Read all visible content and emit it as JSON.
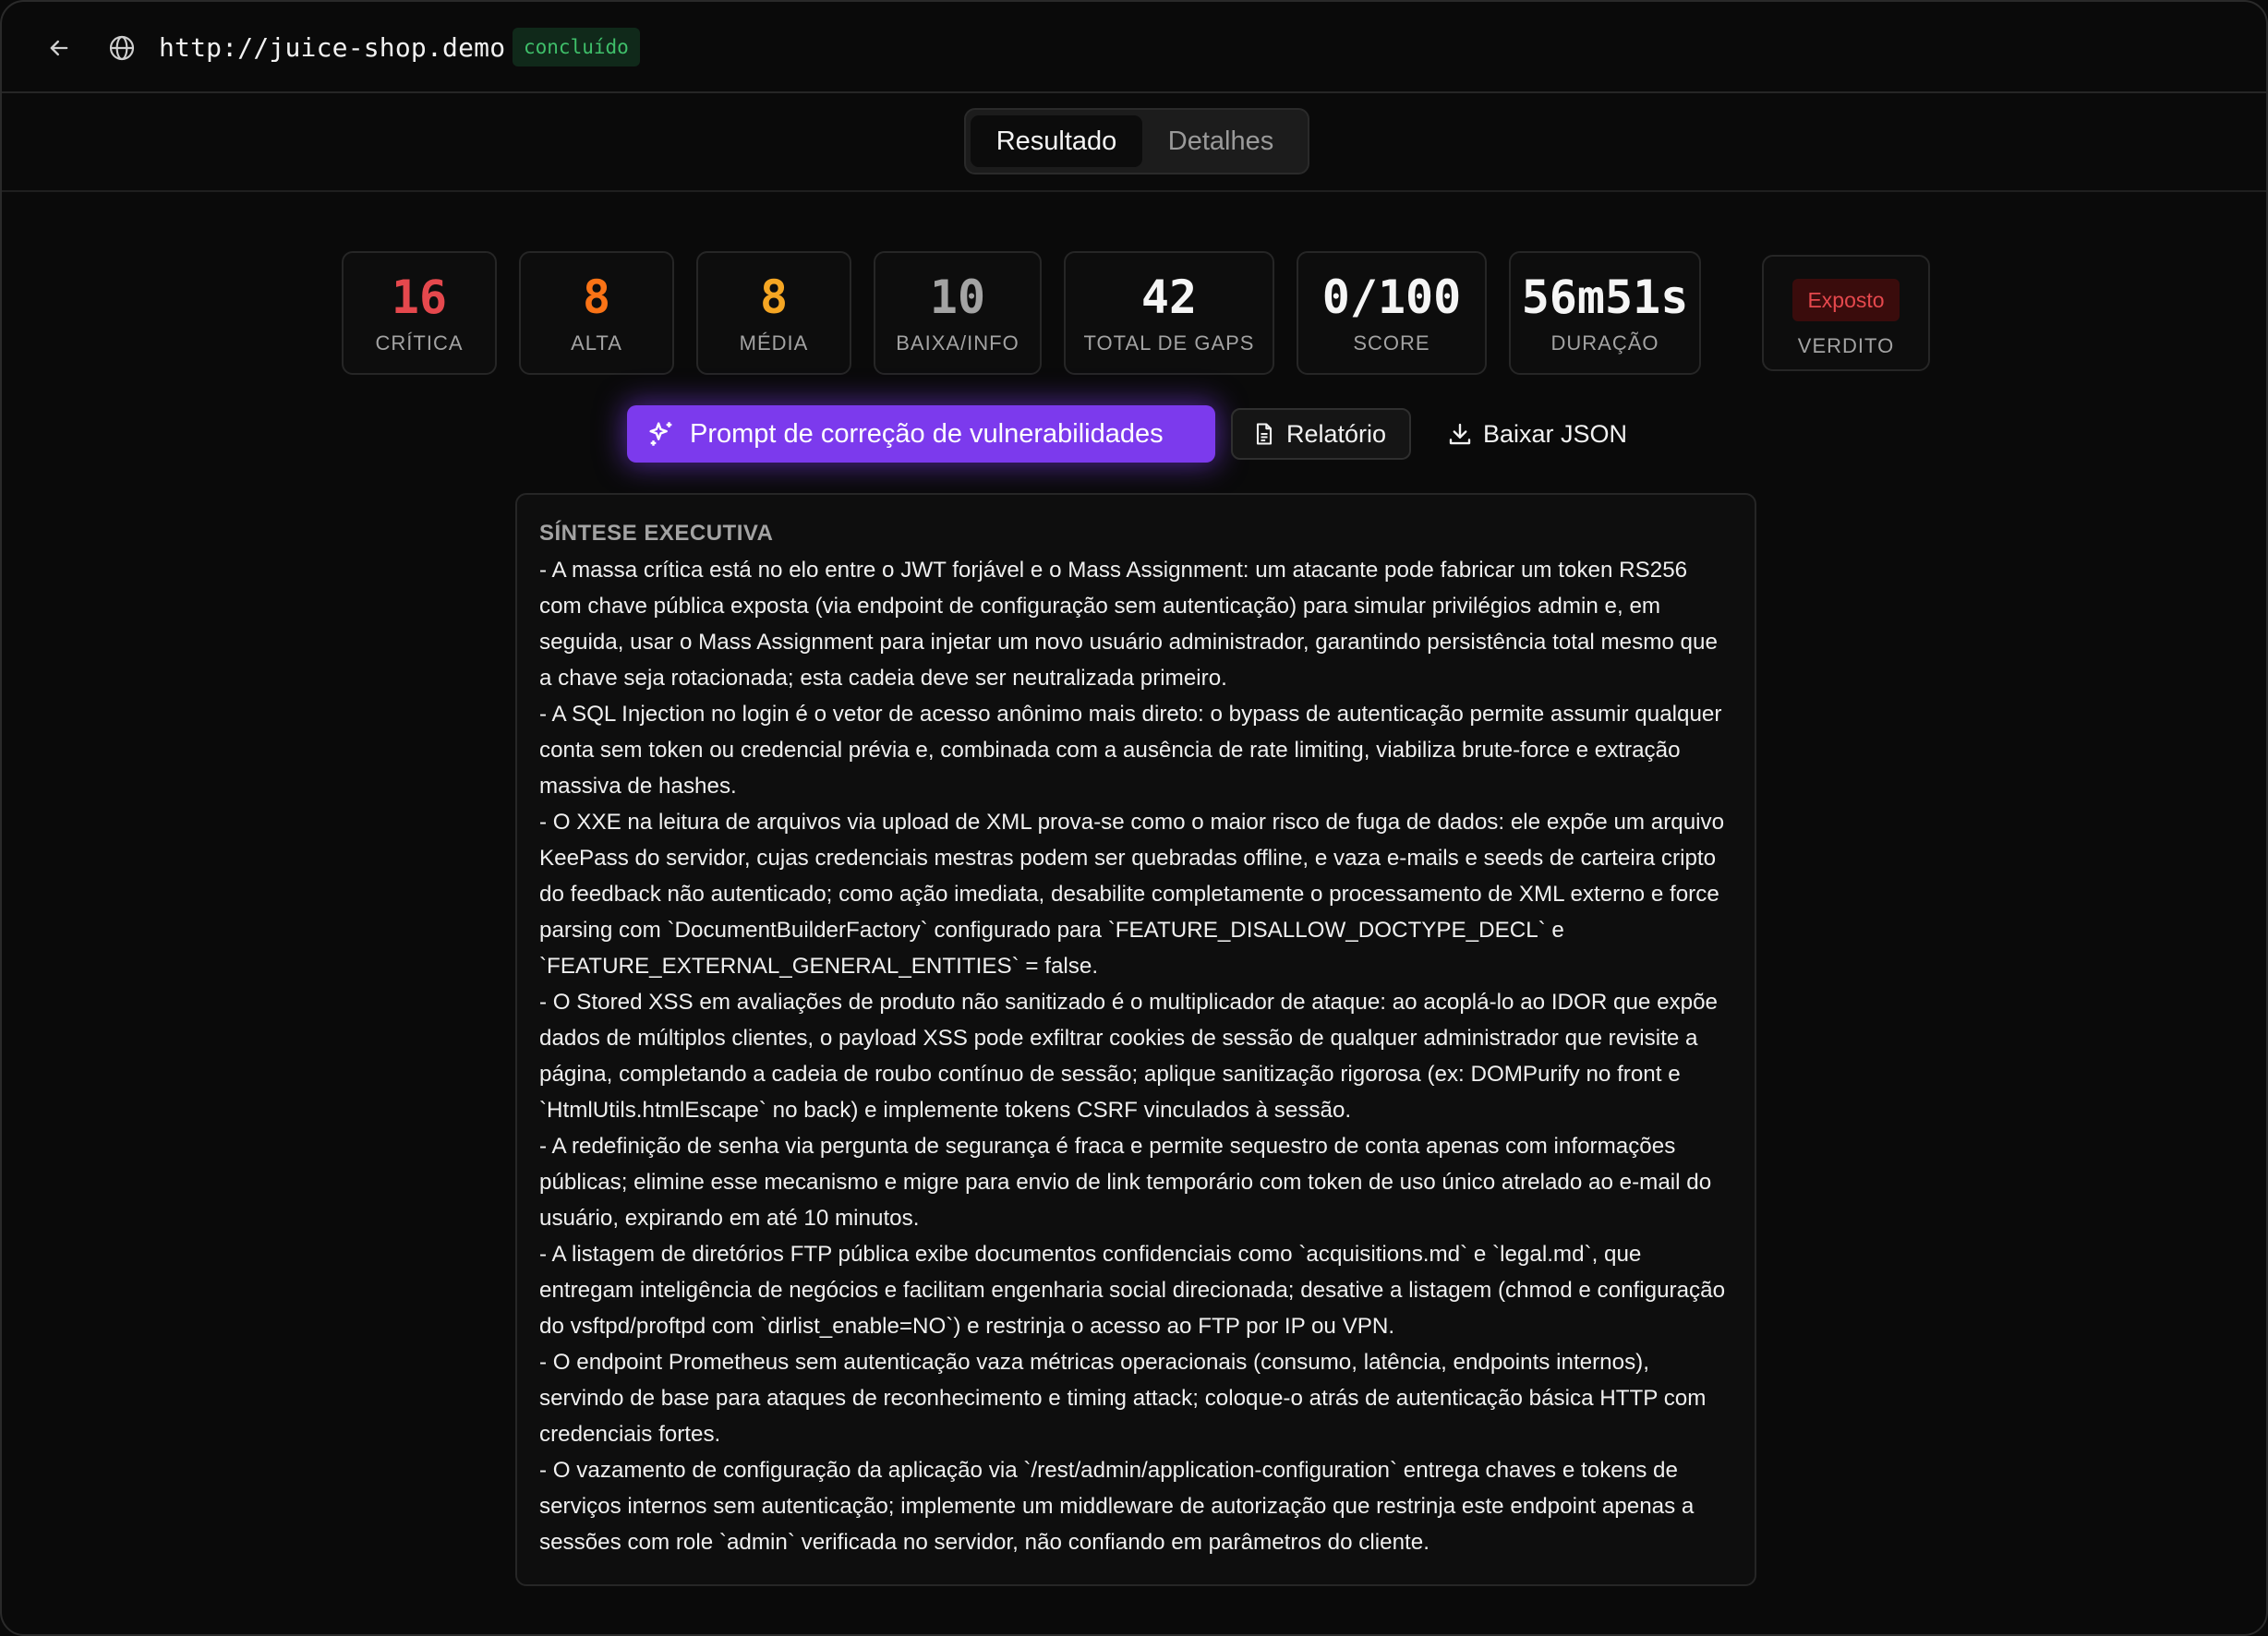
{
  "header": {
    "url": "http://juice-shop.demo",
    "status": "concluído"
  },
  "tabs": [
    {
      "label": "Resultado",
      "active": true
    },
    {
      "label": "Detalhes",
      "active": false
    }
  ],
  "stats": [
    {
      "value": "16",
      "label": "CRÍTICA",
      "color": "#e5484d"
    },
    {
      "value": "8",
      "label": "ALTA",
      "color": "#f97316"
    },
    {
      "value": "8",
      "label": "MÉDIA",
      "color": "#f5a623"
    },
    {
      "value": "10",
      "label": "BAIXA/INFO",
      "color": "#a3a3a3"
    },
    {
      "value": "42",
      "label": "TOTAL DE GAPS",
      "color": "#f5f5f5"
    },
    {
      "value": "0/100",
      "label": "SCORE",
      "color": "#f5f5f5"
    },
    {
      "value": "56m51s",
      "label": "DURAÇÃO",
      "color": "#f5f5f5"
    }
  ],
  "verdict": {
    "value": "Exposto",
    "label": "VERDITO"
  },
  "actions": {
    "prompt_label": "Prompt de correção de vulnerabilidades",
    "report_label": "Relatório",
    "json_label": "Baixar JSON"
  },
  "summary": {
    "title": "SÍNTESE EXECUTIVA",
    "paragraphs": [
      "- A massa crítica está no elo entre o JWT forjável e o Mass Assignment: um atacante pode fabricar um token RS256 com chave pública exposta (via endpoint de configuração sem autenticação) para simular privilégios admin e, em seguida, usar o Mass Assignment para injetar um novo usuário administrador, garantindo persistência total mesmo que a chave seja rotacionada; esta cadeia deve ser neutralizada primeiro.",
      "- A SQL Injection no login é o vetor de acesso anônimo mais direto: o bypass de autenticação permite assumir qualquer conta sem token ou credencial prévia e, combinada com a ausência de rate limiting, viabiliza brute-force e extração massiva de hashes.",
      "- O XXE na leitura de arquivos via upload de XML prova-se como o maior risco de fuga de dados: ele expõe um arquivo KeePass do servidor, cujas credenciais mestras podem ser quebradas offline, e vaza e-mails e seeds de carteira cripto do feedback não autenticado; como ação imediata, desabilite completamente o processamento de XML externo e force parsing com `DocumentBuilderFactory` configurado para `FEATURE_DISALLOW_DOCTYPE_DECL` e `FEATURE_EXTERNAL_GENERAL_ENTITIES` = false.",
      "- O Stored XSS em avaliações de produto não sanitizado é o multiplicador de ataque: ao acoplá-lo ao IDOR que expõe dados de múltiplos clientes, o payload XSS pode exfiltrar cookies de sessão de qualquer administrador que revisite a página, completando a cadeia de roubo contínuo de sessão; aplique sanitização rigorosa (ex: DOMPurify no front e `HtmlUtils.htmlEscape` no back) e implemente tokens CSRF vinculados à sessão.",
      "- A redefinição de senha via pergunta de segurança é fraca e permite sequestro de conta apenas com informações públicas; elimine esse mecanismo e migre para envio de link temporário com token de uso único atrelado ao e-mail do usuário, expirando em até 10 minutos.",
      "- A listagem de diretórios FTP pública exibe documentos confidenciais como `acquisitions.md` e `legal.md`, que entregam inteligência de negócios e facilitam engenharia social direcionada; desative a listagem (chmod e configuração do vsftpd/proftpd com `dirlist_enable=NO`) e restrinja o acesso ao FTP por IP ou VPN.",
      "- O endpoint Prometheus sem autenticação vaza métricas operacionais (consumo, latência, endpoints internos), servindo de base para ataques de reconhecimento e timing attack; coloque-o atrás de autenticação básica HTTP com credenciais fortes.",
      "- O vazamento de configuração da aplicação via `/rest/admin/application-configuration` entrega chaves e tokens de serviços internos sem autenticação; implemente um middleware de autorização que restrinja este endpoint apenas a sessões com role `admin` verificada no servidor, não confiando em parâmetros do cliente."
    ]
  }
}
